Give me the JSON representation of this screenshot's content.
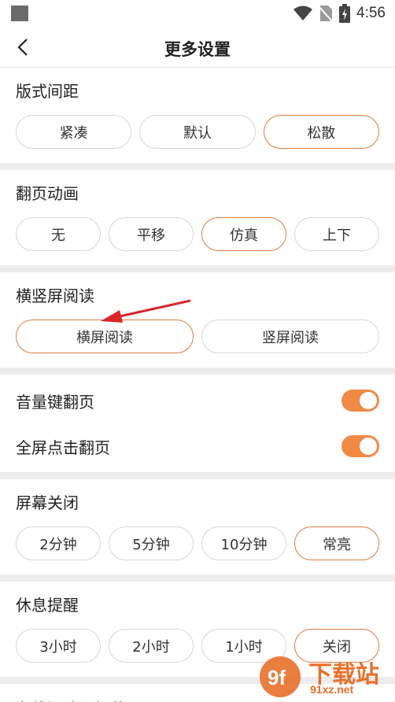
{
  "status_bar": {
    "time": "4:56"
  },
  "header": {
    "title": "更多设置"
  },
  "sections": {
    "layout": {
      "title": "版式间距",
      "options": [
        "紧凑",
        "默认",
        "松散"
      ],
      "selected": "松散"
    },
    "page_anim": {
      "title": "翻页动画",
      "options": [
        "无",
        "平移",
        "仿真",
        "上下"
      ],
      "selected": "仿真"
    },
    "orientation": {
      "title": "横竖屏阅读",
      "options": [
        "横屏阅读",
        "竖屏阅读"
      ],
      "selected": "横屏阅读"
    },
    "toggles": [
      {
        "label": "音量键翻页",
        "on": true
      },
      {
        "label": "全屏点击翻页",
        "on": true
      }
    ],
    "screen_off": {
      "title": "屏幕关闭",
      "options": [
        "2分钟",
        "5分钟",
        "10分钟",
        "常亮"
      ],
      "selected": "常亮"
    },
    "rest": {
      "title": "休息提醒",
      "options": [
        "3小时",
        "2小时",
        "1小时",
        "关闭"
      ],
      "selected": "关闭"
    },
    "preload": {
      "title": "在线阅读预加载"
    }
  },
  "watermark": {
    "brand": "下载站",
    "url": "91xz.net",
    "logo": "9f"
  },
  "colors": {
    "accent": "#e07a3c",
    "toggle_on": "#f08a45"
  }
}
